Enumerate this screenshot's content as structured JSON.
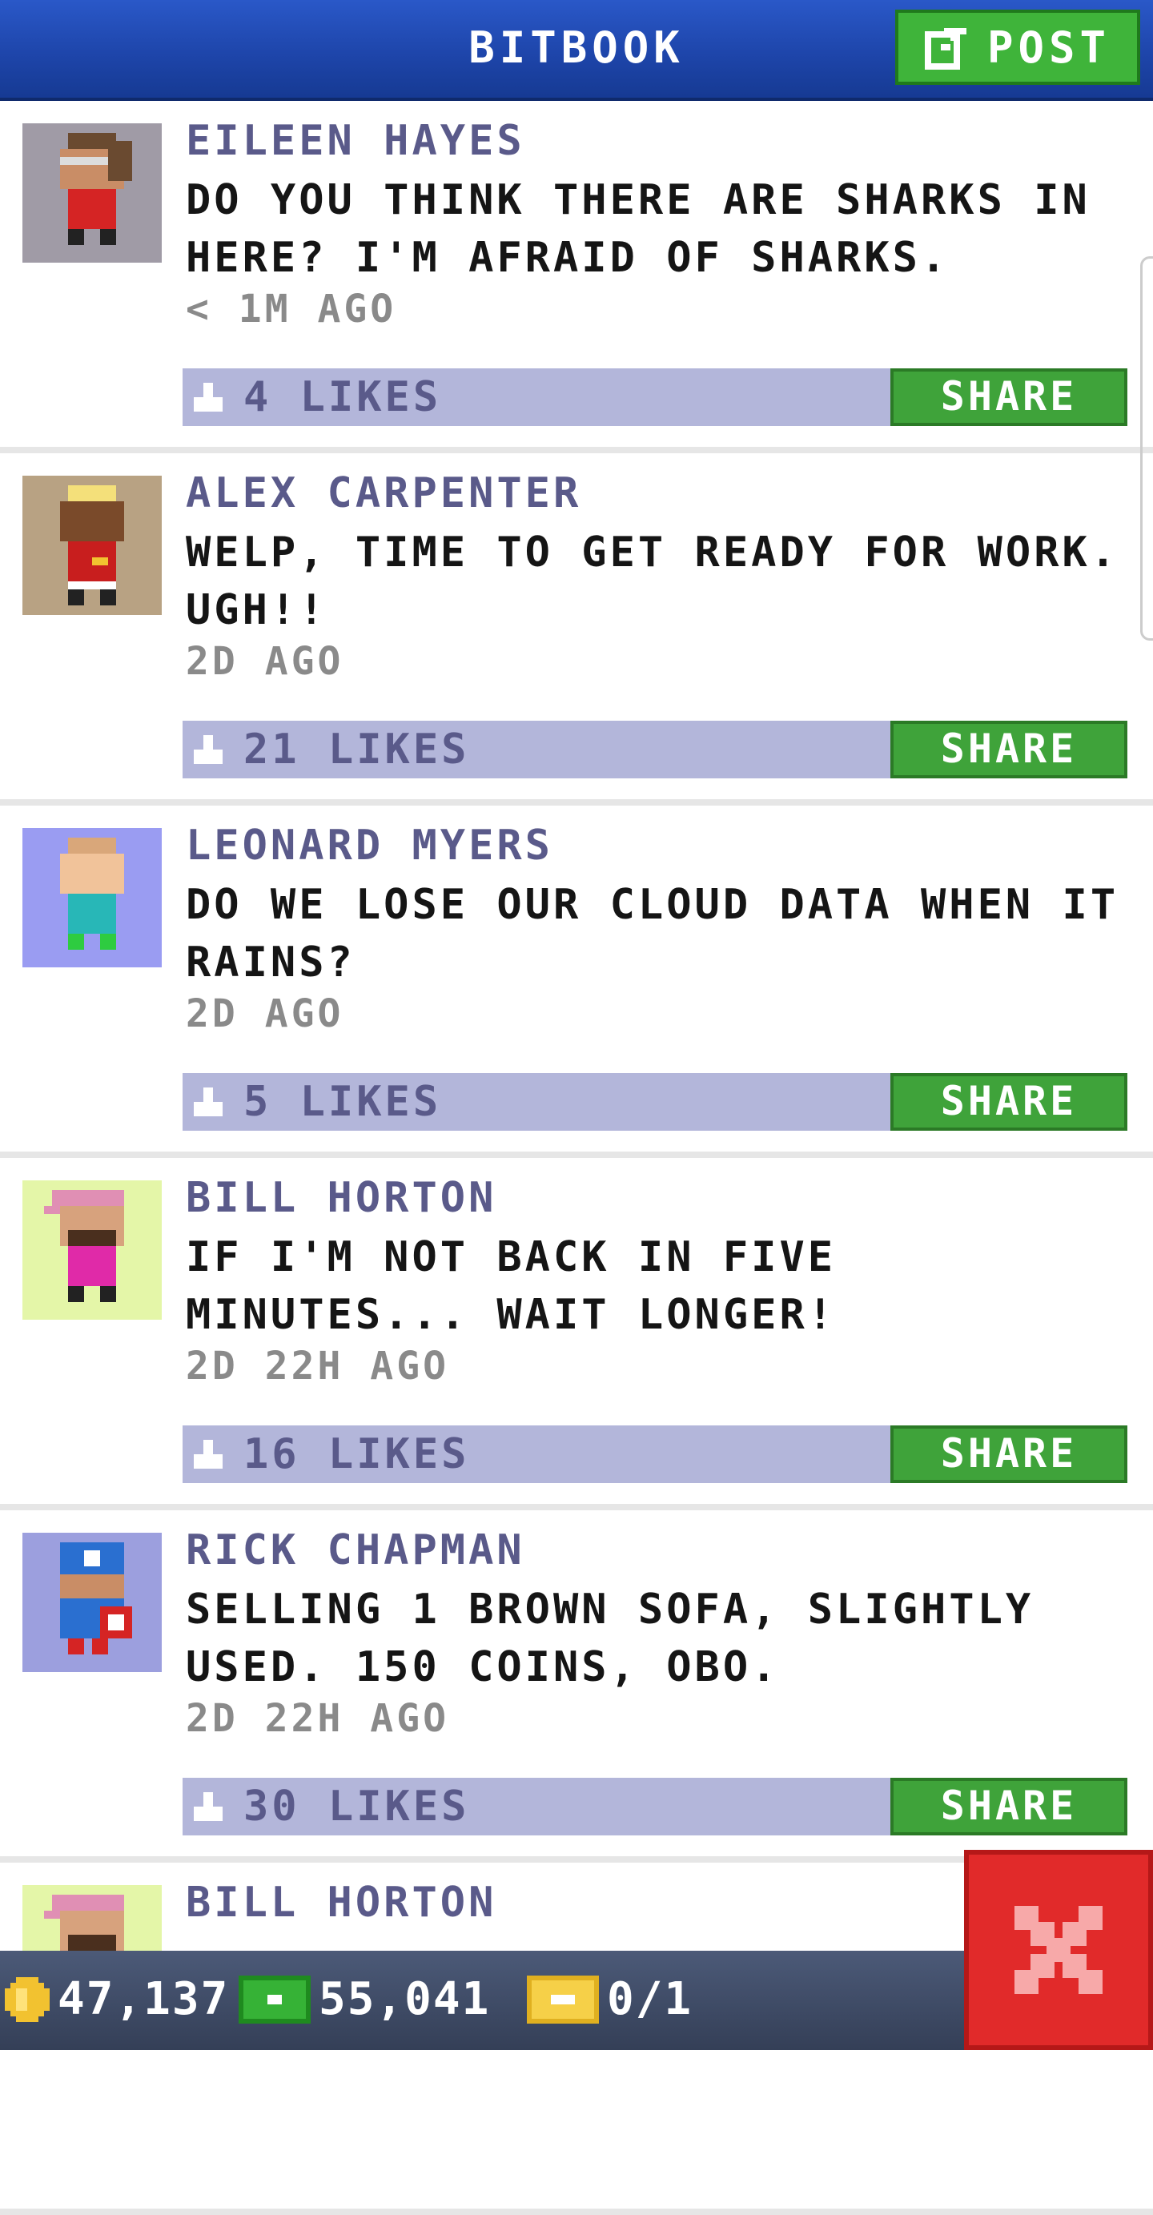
{
  "header": {
    "title": "BITBOOK",
    "post_label": "POST"
  },
  "posts": [
    {
      "author": "EILEEN HAYES",
      "message": "DO YOU THINK THERE ARE SHARKS IN HERE? I'M AFRAID OF SHARKS.",
      "time": "< 1M AGO",
      "likes": "4 LIKES",
      "share": "SHARE",
      "avatar_bg": "#a09ba6"
    },
    {
      "author": "ALEX CARPENTER",
      "message": "WELP, TIME TO GET READY FOR WORK. UGH!!",
      "time": "2D AGO",
      "likes": "21 LIKES",
      "share": "SHARE",
      "avatar_bg": "#b8a283"
    },
    {
      "author": "LEONARD MYERS",
      "message": "DO WE LOSE OUR CLOUD DATA WHEN IT RAINS?",
      "time": "2D AGO",
      "likes": "5 LIKES",
      "share": "SHARE",
      "avatar_bg": "#9a9cf2"
    },
    {
      "author": "BILL HORTON",
      "message": "IF I'M NOT BACK IN FIVE MINUTES... WAIT LONGER!",
      "time": "2D 22H AGO",
      "likes": "16 LIKES",
      "share": "SHARE",
      "avatar_bg": "#e4f6a8"
    },
    {
      "author": "RICK CHAPMAN",
      "message": "SELLING 1 BROWN SOFA, SLIGHTLY USED. 150 COINS, OBO.",
      "time": "2D 22H AGO",
      "likes": "30 LIKES",
      "share": "SHARE",
      "avatar_bg": "#9c9fde"
    },
    {
      "author": "BILL HORTON",
      "avatar_bg": "#e4f6a8"
    }
  ],
  "status": {
    "coins": "47,137",
    "bux": "55,041",
    "tickets": "0/1"
  },
  "colors": {
    "header": "#1d44a8",
    "accent_green": "#3fa33a",
    "likes_bar": "#b3b6da",
    "close_red": "#e12a2a"
  },
  "icons": [
    "compose-icon",
    "thumbs-up-icon",
    "coin-icon",
    "bux-icon",
    "ticket-icon",
    "close-icon"
  ]
}
